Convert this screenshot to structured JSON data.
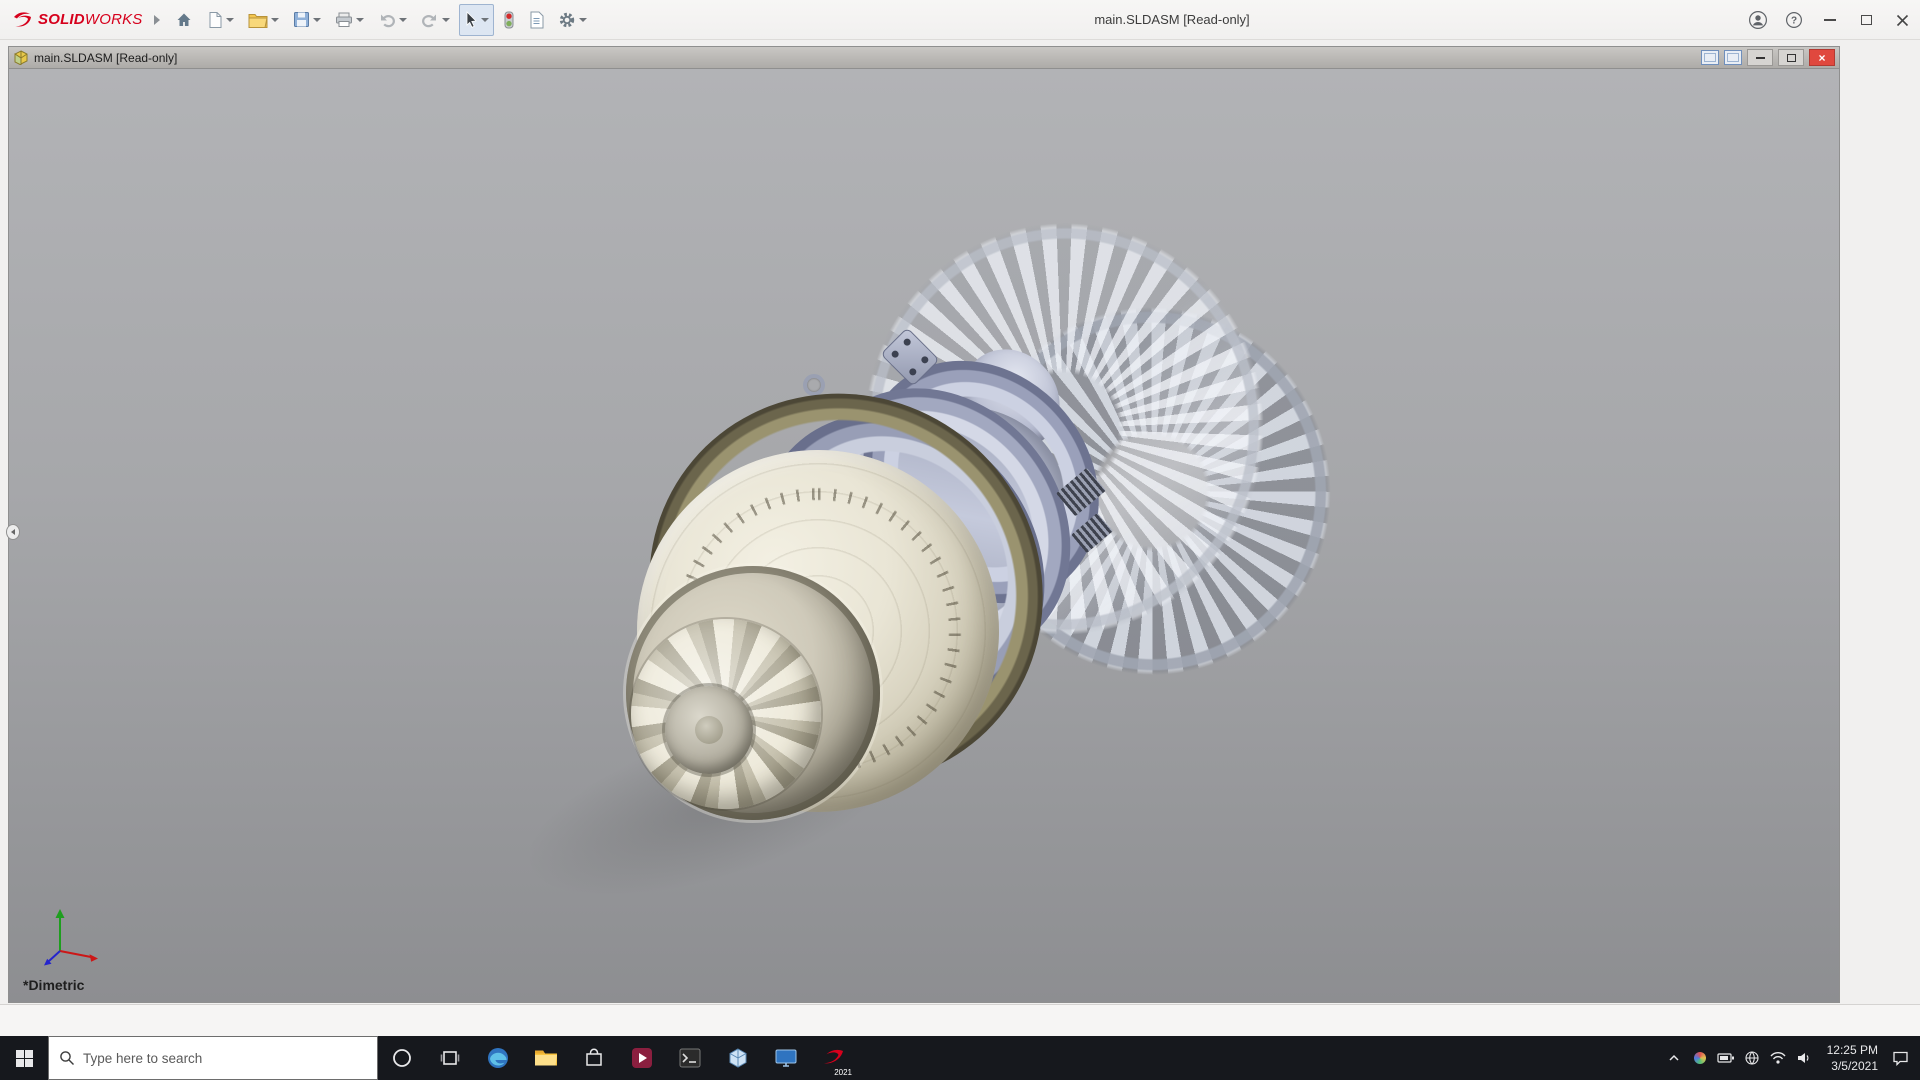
{
  "app": {
    "brand": {
      "solid": "SOLID",
      "works": "WORKS"
    },
    "window_title": "main.SLDASM [Read-only]"
  },
  "doc_window": {
    "title": "main.SLDASM [Read-only]"
  },
  "viewport": {
    "orientation_label": "*Dimetric"
  },
  "taskbar": {
    "search_placeholder": "Type here to search",
    "solidworks_badge": "2021",
    "clock": {
      "time": "12:25 PM",
      "date": "3/5/2021"
    }
  },
  "colors": {
    "brand_red": "#d6001c",
    "taskbar_bg": "#16181d",
    "doc_close_red": "#e0483e",
    "viewport_gray_top": "#b2b3b6",
    "viewport_gray_bottom": "#8d8e91"
  }
}
